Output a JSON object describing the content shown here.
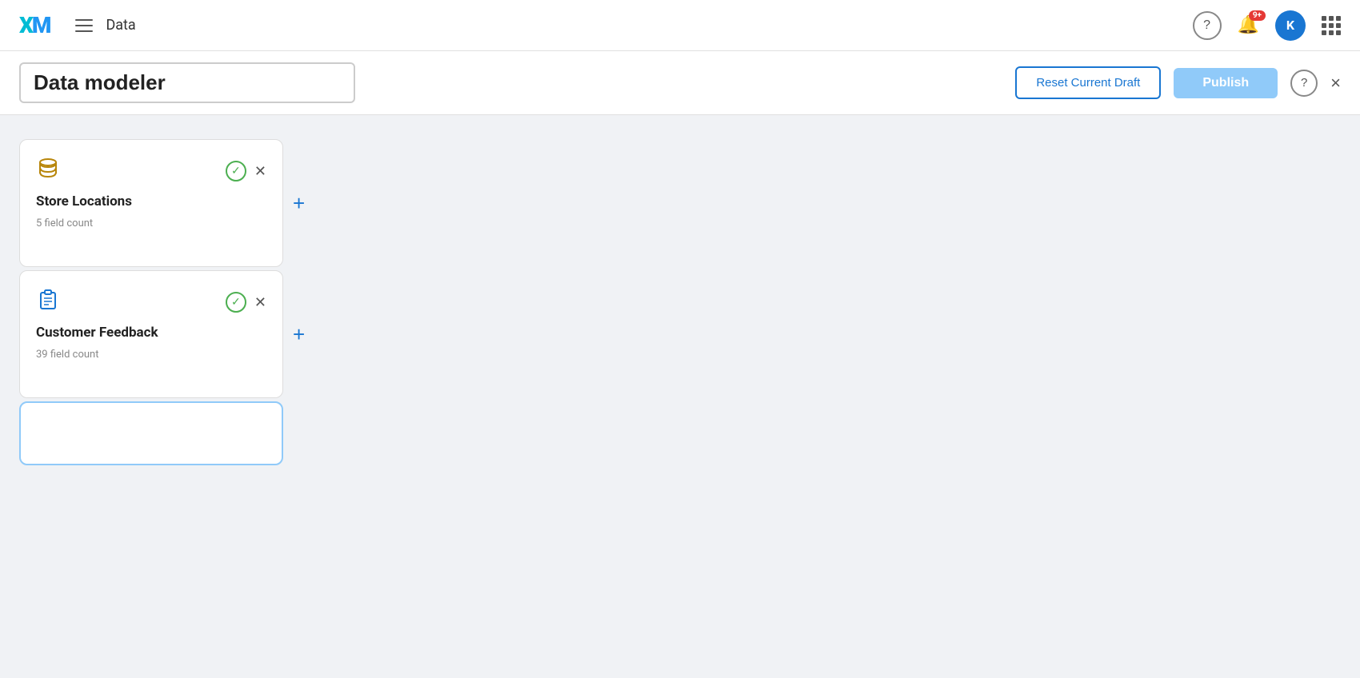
{
  "nav": {
    "logo": "XM",
    "title": "Data",
    "help_label": "?",
    "notification_badge": "9+",
    "avatar_letter": "K"
  },
  "subheader": {
    "modeler_title": "Data modeler",
    "reset_label": "Reset Current Draft",
    "publish_label": "Publish",
    "help_label": "?",
    "close_label": "×"
  },
  "cards": [
    {
      "id": "store-locations",
      "name": "Store Locations",
      "field_count": "5 field count",
      "icon_type": "database",
      "icon_symbol": "🗄"
    },
    {
      "id": "customer-feedback",
      "name": "Customer Feedback",
      "field_count": "39 field count",
      "icon_type": "clipboard",
      "icon_symbol": "📋"
    }
  ],
  "plus_label": "+"
}
